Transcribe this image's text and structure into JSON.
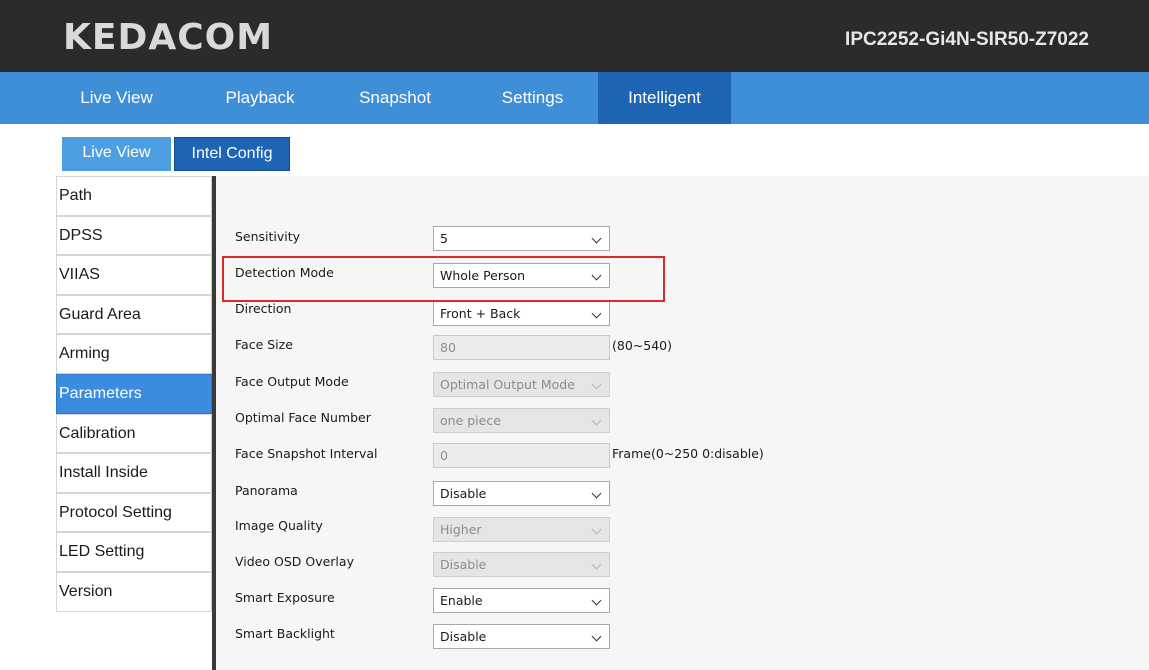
{
  "header": {
    "logo": "KEDACOM",
    "model": "IPC2252-Gi4N-SIR50-Z7022"
  },
  "nav": {
    "tabs": [
      {
        "label": "Live View"
      },
      {
        "label": "Playback"
      },
      {
        "label": "Snapshot"
      },
      {
        "label": "Settings"
      },
      {
        "label": "Intelligent",
        "active": true
      }
    ]
  },
  "subtabs": {
    "live_view": "Live View",
    "intel_config": "Intel Config",
    "active": "Intel Config"
  },
  "sidebar": {
    "items": [
      {
        "label": "Path"
      },
      {
        "label": "DPSS"
      },
      {
        "label": "VIIAS"
      },
      {
        "label": "Guard Area"
      },
      {
        "label": "Arming"
      },
      {
        "label": "Parameters",
        "active": true
      },
      {
        "label": "Calibration"
      },
      {
        "label": "Install Inside"
      },
      {
        "label": "Protocol Setting"
      },
      {
        "label": "LED Setting"
      },
      {
        "label": "Version"
      }
    ]
  },
  "params": {
    "sensitivity": {
      "label": "Sensitivity",
      "value": "5",
      "enabled": true
    },
    "detection_mode": {
      "label": "Detection Mode",
      "value": "Whole Person",
      "enabled": true
    },
    "direction": {
      "label": "Direction",
      "value": "Front + Back",
      "enabled": true
    },
    "face_size": {
      "label": "Face Size",
      "value": "80",
      "hint": "(80~540)",
      "enabled": false
    },
    "face_output_mode": {
      "label": "Face Output Mode",
      "value": "Optimal Output Mode",
      "enabled": false
    },
    "optimal_face_number": {
      "label": "Optimal Face Number",
      "value": "one piece",
      "enabled": false
    },
    "face_snapshot_interval": {
      "label": "Face Snapshot Interval",
      "value": "0",
      "hint": "Frame(0~250 0:disable)",
      "enabled": false
    },
    "panorama": {
      "label": "Panorama",
      "value": "Disable",
      "enabled": true
    },
    "image_quality": {
      "label": "Image Quality",
      "value": "Higher",
      "enabled": false
    },
    "video_osd_overlay": {
      "label": "Video OSD Overlay",
      "value": "Disable",
      "enabled": false
    },
    "smart_exposure": {
      "label": "Smart Exposure",
      "value": "Enable",
      "enabled": true
    },
    "smart_backlight": {
      "label": "Smart Backlight",
      "value": "Disable",
      "enabled": true
    }
  },
  "colors": {
    "header_bg": "#2b2b2b",
    "nav_bg": "#3e8fd8",
    "nav_active": "#1e65b5",
    "highlight": "#e0272a"
  }
}
